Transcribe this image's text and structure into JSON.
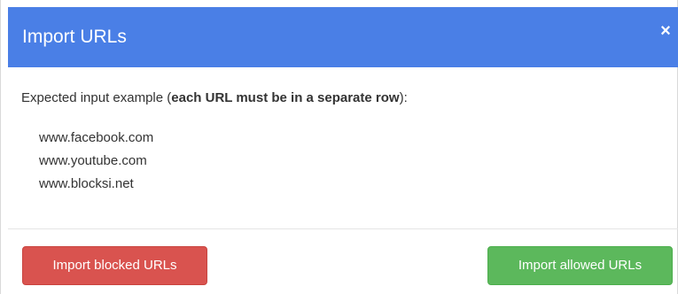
{
  "dialog": {
    "title": "Import URLs",
    "close_symbol": "×",
    "close_icon": "close-icon"
  },
  "body": {
    "instruction_prefix": "Expected input example (",
    "instruction_bold": "each URL must be in a separate row",
    "instruction_suffix": "):",
    "example_urls": [
      "www.facebook.com",
      "www.youtube.com",
      "www.blocksi.net"
    ]
  },
  "footer": {
    "blocked_button_label": "Import blocked URLs",
    "allowed_button_label": "Import allowed URLs"
  },
  "colors": {
    "header": "#4a7fe6",
    "blocked_button": "#d9534f",
    "allowed_button": "#5cb85c"
  }
}
